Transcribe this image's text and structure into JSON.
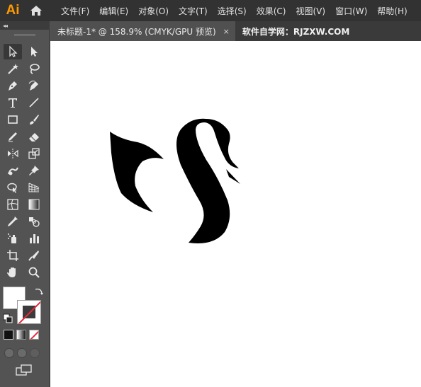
{
  "app": {
    "logo_text": "Ai",
    "home_icon": "home-icon"
  },
  "menu": [
    "文件(F)",
    "编辑(E)",
    "对象(O)",
    "文字(T)",
    "选择(S)",
    "效果(C)",
    "视图(V)",
    "窗口(W)",
    "帮助(H)"
  ],
  "toolpanel": {
    "collapse_label": "◂◂"
  },
  "tabs": [
    {
      "label": "未标题-1* @ 158.9% (CMYK/GPU 预览)",
      "close": "×"
    },
    {
      "label": "软件自学网：RJZXW.COM"
    }
  ],
  "colors": {
    "accent": "#ff9a00",
    "menubar": "#323232",
    "panel": "#535353",
    "tab_active": "#505050",
    "tab_bar": "#3a3a3a",
    "canvas": "#ffffff",
    "artwork": "#000000"
  },
  "tools": [
    "selection-tool",
    "direct-selection-tool",
    "magic-wand-tool",
    "lasso-tool",
    "pen-tool",
    "curvature-tool",
    "type-tool",
    "line-segment-tool",
    "rectangle-tool",
    "paintbrush-tool",
    "shaper-tool",
    "eraser-tool",
    "reflect-tool",
    "scale-tool",
    "warp-tool",
    "puppet-warp-tool",
    "shape-builder-tool",
    "perspective-grid-tool",
    "mesh-tool",
    "gradient-tool",
    "eyedropper-tool",
    "blend-tool",
    "symbol-sprayer-tool",
    "column-graph-tool",
    "artboard-tool",
    "slice-tool",
    "hand-tool",
    "zoom-tool"
  ]
}
